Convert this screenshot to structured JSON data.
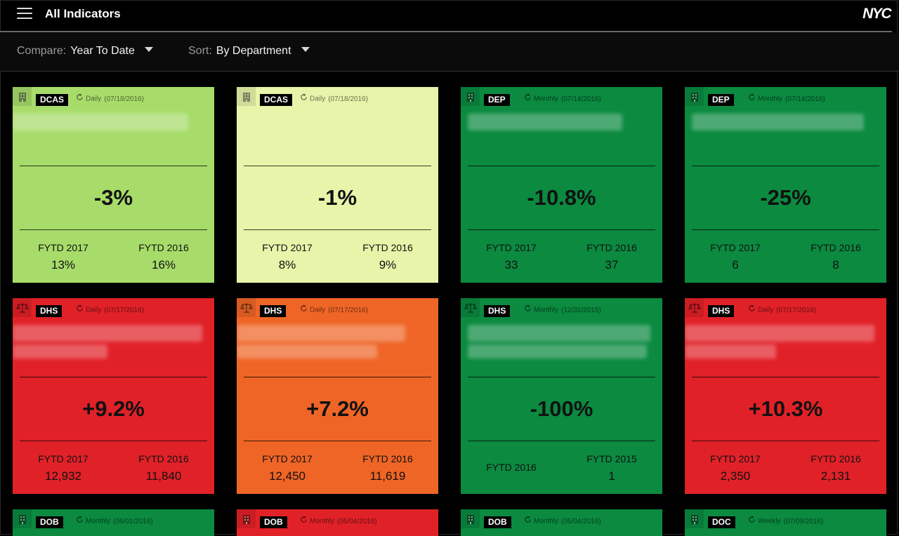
{
  "header": {
    "title": "All Indicators",
    "logo": "NYC"
  },
  "filters": {
    "compare": {
      "label": "Compare:",
      "value": "Year To Date"
    },
    "sort": {
      "label": "Sort:",
      "value": "By Department"
    }
  },
  "cards": [
    {
      "dept": "DCAS",
      "freq": "Daily",
      "date": "(07/18/2016)",
      "change": "-3%",
      "labels": [
        "FYTD 2017",
        "FYTD 2016"
      ],
      "values": [
        "13%",
        "16%"
      ],
      "color": "#a7dc6a",
      "icon": "building-icon"
    },
    {
      "dept": "DCAS",
      "freq": "Daily",
      "date": "(07/18/2016)",
      "change": "-1%",
      "labels": [
        "FYTD 2017",
        "FYTD 2016"
      ],
      "values": [
        "8%",
        "9%"
      ],
      "color": "#e7f4a9",
      "icon": "building-icon"
    },
    {
      "dept": "DEP",
      "freq": "Monthly",
      "date": "(07/14/2016)",
      "change": "-10.8%",
      "labels": [
        "FYTD 2017",
        "FYTD 2016"
      ],
      "values": [
        "33",
        "37"
      ],
      "color": "#0b8a40",
      "icon": "building-icon"
    },
    {
      "dept": "DEP",
      "freq": "Monthly",
      "date": "(07/14/2016)",
      "change": "-25%",
      "labels": [
        "FYTD 2017",
        "FYTD 2016"
      ],
      "values": [
        "6",
        "8"
      ],
      "color": "#0b8a40",
      "icon": "building-icon"
    },
    {
      "dept": "DHS",
      "freq": "Daily",
      "date": "(07/17/2016)",
      "change": "+9.2%",
      "labels": [
        "FYTD 2017",
        "FYTD 2016"
      ],
      "values": [
        "12,932",
        "11,840"
      ],
      "color": "#e12128",
      "icon": "scales-icon"
    },
    {
      "dept": "DHS",
      "freq": "Daily",
      "date": "(07/17/2016)",
      "change": "+7.2%",
      "labels": [
        "FYTD 2017",
        "FYTD 2016"
      ],
      "values": [
        "12,450",
        "11,619"
      ],
      "color": "#ef6526",
      "icon": "scales-icon"
    },
    {
      "dept": "DHS",
      "freq": "Monthly",
      "date": "(12/31/2015)",
      "change": "-100%",
      "labels": [
        "FYTD 2016",
        "FYTD 2015"
      ],
      "values": [
        "",
        "1"
      ],
      "color": "#0b8a40",
      "icon": "scales-icon"
    },
    {
      "dept": "DHS",
      "freq": "Daily",
      "date": "(07/17/2016)",
      "change": "+10.3%",
      "labels": [
        "FYTD 2017",
        "FYTD 2016"
      ],
      "values": [
        "2,350",
        "2,131"
      ],
      "color": "#e12128",
      "icon": "scales-icon"
    },
    {
      "dept": "DOB",
      "freq": "Monthly",
      "date": "(06/01/2016)",
      "change": "",
      "labels": [
        "",
        ""
      ],
      "values": [
        "",
        ""
      ],
      "color": "#0b8a40",
      "icon": "building-icon"
    },
    {
      "dept": "DOB",
      "freq": "Monthly",
      "date": "(05/04/2016)",
      "change": "",
      "labels": [
        "",
        ""
      ],
      "values": [
        "",
        ""
      ],
      "color": "#e12128",
      "icon": "building-icon"
    },
    {
      "dept": "DOB",
      "freq": "Monthly",
      "date": "(05/04/2016)",
      "change": "",
      "labels": [
        "",
        ""
      ],
      "values": [
        "",
        ""
      ],
      "color": "#0b8a40",
      "icon": "building-icon"
    },
    {
      "dept": "DOC",
      "freq": "Weekly",
      "date": "(07/09/2016)",
      "change": "",
      "labels": [
        "",
        ""
      ],
      "values": [
        "",
        ""
      ],
      "color": "#0b8a40",
      "icon": "building-icon"
    }
  ]
}
